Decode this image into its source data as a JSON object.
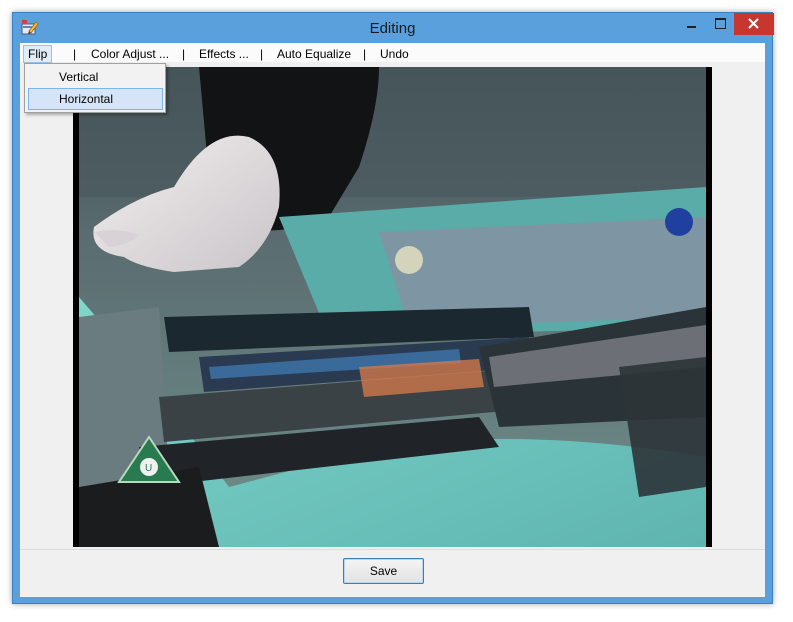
{
  "window": {
    "title": "Editing"
  },
  "menu": {
    "items": [
      {
        "label": "Flip"
      },
      {
        "label": "Color Adjust ..."
      },
      {
        "label": "Effects ..."
      },
      {
        "label": "Auto Equalize"
      },
      {
        "label": "Undo"
      }
    ],
    "separator": "|"
  },
  "flip_menu": {
    "items": [
      {
        "label": "Vertical"
      },
      {
        "label": "Horizontal"
      }
    ]
  },
  "footer": {
    "save_label": "Save"
  },
  "colors": {
    "titlebar": "#5aa0dc",
    "close_button": "#c7372f",
    "menu_highlight": "#d5e5f7",
    "save_border": "#3c7fb1"
  },
  "icons": {
    "app": "pencil-icon",
    "minimize": "minimize-icon",
    "maximize": "maximize-icon",
    "close": "close-icon"
  }
}
